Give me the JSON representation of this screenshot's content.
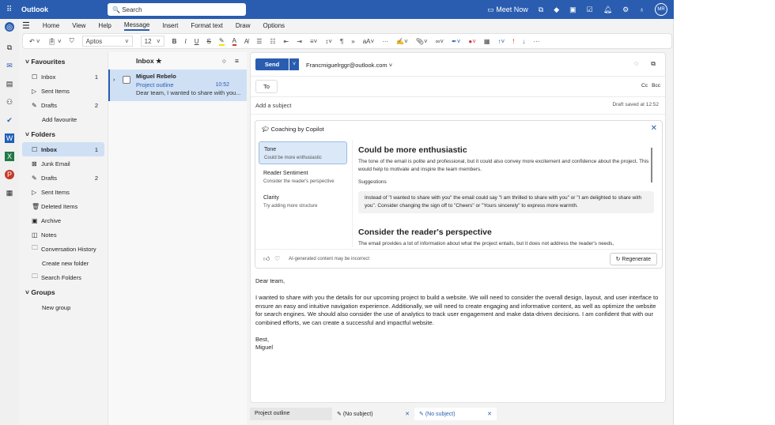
{
  "app": {
    "title": "Outlook",
    "search_placeholder": "Search",
    "meet_now": "Meet Now",
    "avatar": "MR"
  },
  "tabs": [
    "Home",
    "View",
    "Help",
    "Message",
    "Insert",
    "Format text",
    "Draw",
    "Options"
  ],
  "ribbon": {
    "font": "Aptos",
    "size": "12"
  },
  "folders": {
    "favourites_label": "Favourites",
    "favourites": [
      {
        "label": "Inbox",
        "count": "1",
        "icon": "inbox-icon"
      },
      {
        "label": "Sent Items",
        "count": "",
        "icon": "send-icon"
      },
      {
        "label": "Drafts",
        "count": "2",
        "icon": "pencil-icon"
      }
    ],
    "add_favourite": "Add favourite",
    "folders_label": "Folders",
    "items": [
      {
        "label": "Inbox",
        "count": "1",
        "icon": "inbox-icon"
      },
      {
        "label": "Junk Email",
        "count": "",
        "icon": "junk-icon"
      },
      {
        "label": "Drafts",
        "count": "2",
        "icon": "pencil-icon"
      },
      {
        "label": "Sent Items",
        "count": "",
        "icon": "send-icon"
      },
      {
        "label": "Deleted Items",
        "count": "",
        "icon": "trash-icon"
      },
      {
        "label": "Archive",
        "count": "",
        "icon": "archive-icon"
      },
      {
        "label": "Notes",
        "count": "",
        "icon": "note-icon"
      },
      {
        "label": "Conversation History",
        "count": "",
        "icon": "folder-icon"
      }
    ],
    "create_new_folder": "Create new folder",
    "search_folders": "Search Folders",
    "groups_label": "Groups",
    "new_group": "New group"
  },
  "list": {
    "title": "Inbox",
    "message": {
      "sender": "Miguel Rebelo",
      "subject": "Project outline",
      "time": "10:52",
      "preview": "Dear team, I wanted to share with you..."
    }
  },
  "compose": {
    "send": "Send",
    "from": "Francmiguelrggr@outlook.com",
    "to_label": "To",
    "cc": "Cc",
    "bcc": "Bcc",
    "subject_placeholder": "Add a subject",
    "draft_saved": "Draft saved at 12:52",
    "coach": {
      "title": "Coaching by Copilot",
      "nav": [
        {
          "title": "Tone",
          "sub": "Could be more enthusiastic"
        },
        {
          "title": "Reader Sentiment",
          "sub": "Consider the reader's perspective"
        },
        {
          "title": "Clarity",
          "sub": "Try adding more structure"
        }
      ],
      "h1": "Could be more enthusiastic",
      "p1": "The tone of the email is polite and professional, but it could also convey more excitement and confidence about the project. This would help to motivate and inspire the team members.",
      "suggestions_label": "Suggestions",
      "suggestion": "Instead of \"I wanted to share with you\" the email could say \"I am thrilled to share with you\" or \"I am delighted to share with you\". Consider changing the sign off to \"Cheers\" or \"Yours sincerely\" to express more warmth.",
      "h2": "Consider the reader's perspective",
      "p2": "The email provides a lot of information about what the project entails, but it does not address the reader's needs,",
      "disclaimer": "AI-generated content may be incorrect",
      "regenerate": "Regenerate"
    },
    "body": {
      "greeting": "Dear team,",
      "paragraph": "I wanted to share with you the details for our upcoming project to build a website. We will need to consider the overall design, layout, and user interface to ensure an easy and intuitive navigation experience. Additionally, we will need to create engaging and informative content, as well as optimize the website for search engines. We should also consider the use of analytics to track user engagement and make data-driven decisions. I am confident that with our combined efforts, we can create a successful and impactful website.",
      "signoff": "Best,",
      "name": "Miguel"
    }
  },
  "bottom_tabs": [
    {
      "label": "Project outline"
    },
    {
      "label": "(No subject)"
    },
    {
      "label": "(No subject)"
    }
  ]
}
